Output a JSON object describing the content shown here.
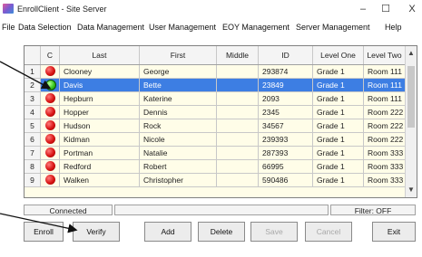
{
  "window": {
    "title": "EnrollClient - Site Server",
    "controls": {
      "minimize": "–",
      "maximize": "☐",
      "close": "X"
    }
  },
  "menu": [
    "File",
    "Data Selection",
    "Data Management",
    "User Management",
    "EOY Management",
    "Server Management",
    "Help"
  ],
  "table": {
    "headers": [
      "",
      "C",
      "Last",
      "First",
      "Middle",
      "ID",
      "Level One",
      "Level Two"
    ],
    "rows": [
      {
        "num": "1",
        "status": "red",
        "last": "Clooney",
        "first": "George",
        "middle": "",
        "id": "293874",
        "level_one": "Grade 1",
        "level_two": "Room 111",
        "selected": false
      },
      {
        "num": "2",
        "status": "green",
        "last": "Davis",
        "first": "Bette",
        "middle": "",
        "id": "23849",
        "level_one": "Grade 1",
        "level_two": "Room 111",
        "selected": true
      },
      {
        "num": "3",
        "status": "red",
        "last": "Hepburn",
        "first": "Katerine",
        "middle": "",
        "id": "2093",
        "level_one": "Grade 1",
        "level_two": "Room 111",
        "selected": false
      },
      {
        "num": "4",
        "status": "red",
        "last": "Hopper",
        "first": "Dennis",
        "middle": "",
        "id": "2345",
        "level_one": "Grade 1",
        "level_two": "Room 222",
        "selected": false
      },
      {
        "num": "5",
        "status": "red",
        "last": "Hudson",
        "first": "Rock",
        "middle": "",
        "id": "34567",
        "level_one": "Grade 1",
        "level_two": "Room 222",
        "selected": false
      },
      {
        "num": "6",
        "status": "red",
        "last": "Kidman",
        "first": "Nicole",
        "middle": "",
        "id": "239393",
        "level_one": "Grade 1",
        "level_two": "Room 222",
        "selected": false
      },
      {
        "num": "7",
        "status": "red",
        "last": "Portman",
        "first": "Natalie",
        "middle": "",
        "id": "287393",
        "level_one": "Grade 1",
        "level_two": "Room 333",
        "selected": false
      },
      {
        "num": "8",
        "status": "red",
        "last": "Redford",
        "first": "Robert",
        "middle": "",
        "id": "66995",
        "level_one": "Grade 1",
        "level_two": "Room 333",
        "selected": false
      },
      {
        "num": "9",
        "status": "red",
        "last": "Walken",
        "first": "Christopher",
        "middle": "",
        "id": "590486",
        "level_one": "Grade 1",
        "level_two": "Room 333",
        "selected": false
      }
    ]
  },
  "status": {
    "connection": "Connected",
    "filter": "Filter: OFF"
  },
  "buttons": {
    "enroll": "Enroll",
    "verify": "Verify",
    "add": "Add",
    "delete": "Delete",
    "save": "Save",
    "cancel": "Cancel",
    "exit": "Exit"
  },
  "colors": {
    "selected_row": "#3d7ee3",
    "grid_background": "#fffde8",
    "status_red": "#d81414",
    "status_green": "#38c81e"
  }
}
